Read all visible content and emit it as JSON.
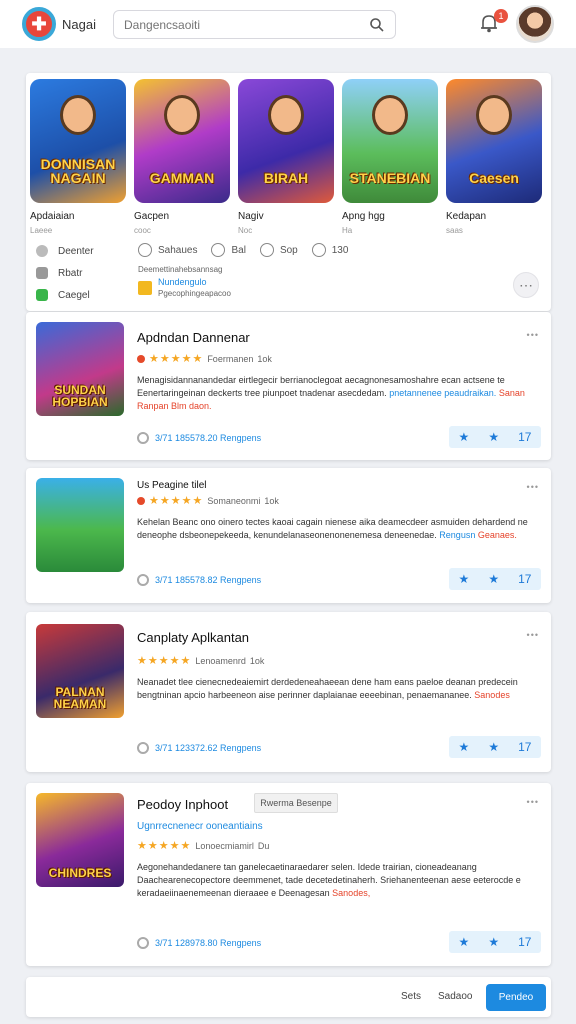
{
  "header": {
    "app_name": "Nagai",
    "search_placeholder": "Dangencsaoiti",
    "notification_count": "1"
  },
  "top_games": [
    {
      "title": "DONNISAN NAGAIN",
      "name": "Apdaiaian",
      "sub": "Laeee"
    },
    {
      "title": "GAMMAN",
      "name": "Gacpen",
      "sub": "cooc"
    },
    {
      "title": "BIRAH",
      "name": "Nagiv",
      "sub": "Noc"
    },
    {
      "title": "STANEBIAN",
      "name": "Apng hgg",
      "sub": "Ha"
    },
    {
      "title": "Caesen",
      "name": "Kedapan",
      "sub": "saas"
    }
  ],
  "left_list": [
    {
      "label": "Deenter",
      "color": "#bbbbbb"
    },
    {
      "label": "Rbatr",
      "color": "#999999"
    },
    {
      "label": "Caegel",
      "color": "#39b54a"
    }
  ],
  "stats": [
    {
      "label": "Sahaues"
    },
    {
      "label": "Bal"
    },
    {
      "label": "Sop"
    },
    {
      "label": "130"
    }
  ],
  "meta_line": "Deemettinahebsannsag",
  "featured_badge": {
    "title": "Nundengulo",
    "sub": "Pgecophingeapacoo"
  },
  "cards": [
    {
      "title": "Apdndan Dannenar",
      "rating_text": "Foermanen",
      "rating_count": "1ok",
      "art_text": "SUNDAN HOPBIAN",
      "desc": "Menagisidannanandedar eirtlegecir berrianoclegoat aecagnonesamoshahre ecan actsene te Eenertaringeinan deckerts tree piunpoet tnadenar asecdedam.",
      "desc_hl": "pnetannenee peaudraikan.",
      "desc_hr": "Sanan Ranpan Blm daon.",
      "foot": "3/71 185578.20 Rengpens"
    },
    {
      "title": "Us Peagine tilel",
      "rating_text": "Somaneonmi",
      "rating_count": "1ok",
      "art_text": "",
      "desc": "Kehelan Beanc ono oinero tectes kaoai cagain nienese aika deamecdeer asmuiden dehardend ne deneophe dsbeonepekeeda, kenundelanaseonenonenemesa deneenedae.",
      "desc_hl": "Rengusn",
      "desc_hr": "Geanaes.",
      "foot": "3/71 185578.82 Rengpens"
    },
    {
      "title": "Canplaty Aplkantan",
      "rating_text": "Lenoamenrd",
      "rating_count": "1ok",
      "art_text": "PALNAN NEAMAN",
      "desc": "Neanadet tlee cienecnedeaiemirt derdedeneahaeean dene ham eans paeloe deanan predecein bengtninan apcio harbeeneon aise perinner daplaianae eeeebinan, penaemananee.",
      "desc_hl": "",
      "desc_hr": "Sanodes",
      "foot": "3/71 123372.62 Rengpens"
    },
    {
      "title": "Peodoy Inphoot",
      "tag": "Rwerma Besenpe",
      "subtitle": "Ugnrrecnenecr ooneantiains",
      "rating_text": "Lonoecmiamirl",
      "rating_count": "Du",
      "art_text": "CHINDRES",
      "desc": "Aegonehandedanere tan ganelecaetinaraedarer selen. Idede trairian, cioneadeanang Daachearenecopectore deemmenet, tade decetedetinaherh. Sriehanenteenan aese eeterocde e keradaeiinaenemeenan dieraaee e Deenagesan",
      "desc_hl": "",
      "desc_hr": "Sanodes,",
      "foot": "3/71 128978.80 Rengpens"
    }
  ],
  "bottom_bar": {
    "link1": "Sets",
    "link2": "Sadaoo",
    "primary": "Pendeo"
  },
  "colors": {
    "accent": "#1d8ae0",
    "star": "#f5a623",
    "danger": "#e5432a"
  }
}
